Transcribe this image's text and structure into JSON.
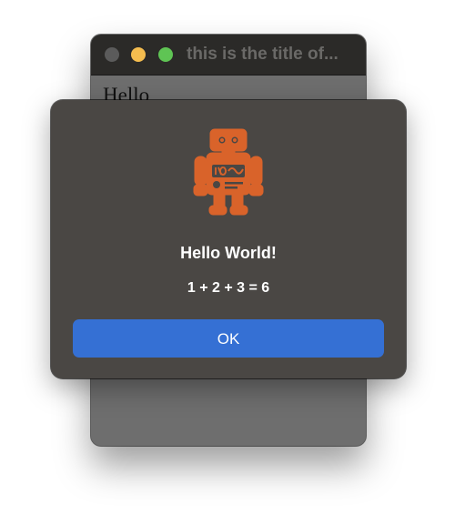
{
  "window": {
    "title": "this is the title of...",
    "content_text": "Hello"
  },
  "dialog": {
    "icon": "robot-icon",
    "title": "Hello World!",
    "message": "1 + 2 + 3 = 6",
    "ok_label": "OK"
  },
  "colors": {
    "accent": "#3570d4",
    "robot": "#d9632a",
    "traffic_min": "#f5bd4f",
    "traffic_max": "#5fc454"
  }
}
